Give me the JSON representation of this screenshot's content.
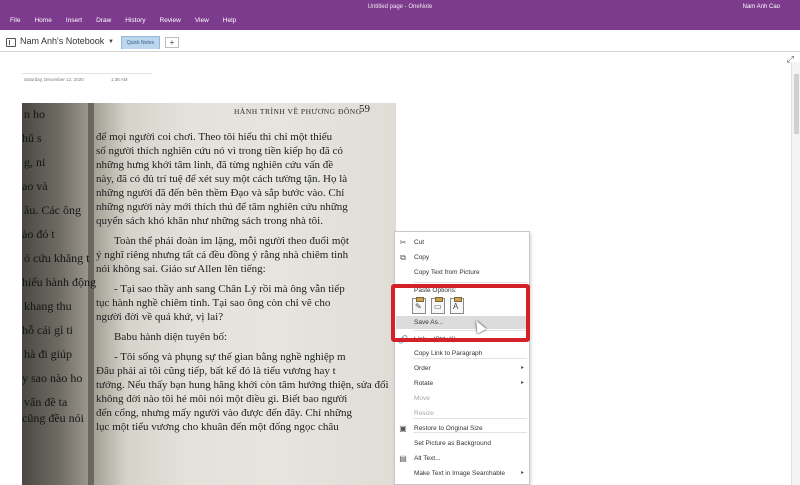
{
  "window": {
    "title": "Untitled page - OneNote",
    "user": "Nam Anh Cao"
  },
  "menu": [
    "File",
    "Home",
    "Insert",
    "Draw",
    "History",
    "Review",
    "View",
    "Help"
  ],
  "notebook": {
    "name": "Nam Anh's Notebook",
    "tab": "Quick Notes",
    "add_tab": "+"
  },
  "page": {
    "date": "Saturday, December 12, 2020",
    "time": "1:36 AM"
  },
  "photo": {
    "header": "HÀNH TRÌNH VỀ PHƯƠNG ĐÔNG",
    "page_number": "59",
    "lines": [
      "để mọi người coi chơi. Theo tôi hiểu thì chỉ một thiểu",
      "số người thích nghiên cứu nó vì trong tiền kiếp họ đã có",
      "những hưng khởi tâm linh, đã từng nghiên cứu vấn đề",
      "này, đã có đủ trí tuệ để xét suy một cách tường tận. Họ là",
      "những người đã đến bên thềm Đạo và sắp bước vào. Chỉ",
      "những người này mới thích thú để tâm nghiên cứu những",
      "quyển sách khó khăn như những sách trong nhà tôi.",
      "",
      "Toàn thể phái đoàn im lặng, mỗi người theo đuổi một",
      "ý nghĩ riêng nhưng tất cả đều đồng ý rằng nhà chiêm tinh",
      "nói không sai. Giáo sư Allen lên tiếng:",
      "",
      "- Tại sao thầy anh sang Chân Lý rồi mà ông vẫn tiếp",
      "tục hành nghề chiêm tinh. Tại sao ông còn chỉ vẽ cho",
      "người đời về quá khứ, vị lai?",
      "",
      "Babu hành diện tuyên bố:",
      "",
      "- Tôi sống và phụng sự thế gian bằng nghề nghiệp m",
      "Đâu phải ai tôi cũng tiếp, bất kể đó là tiểu vương hay t",
      "tướng. Nếu thấy bạn hung hăng khởi còn tâm hướng thiện, sửa đổi",
      "không đời nào tôi hé môi nói một điều gì. Biết bao người",
      "đến cổng, nhưng mấy người vào được đến đây. Chỉ những",
      "lục một tiểu vương cho khuân đến một đống ngọc châu"
    ],
    "left_lines": [
      "n ho",
      "hũ s",
      "g, ni",
      "ao và",
      "âu. Các ông",
      "ào đó t",
      "ó cứu khăng t",
      "hiếu hành động",
      "khang thu",
      "hỗ cái gì ti",
      "hà đi giúp",
      "y sao nào ho",
      "vấn đề ta",
      "cũng đều nói"
    ]
  },
  "context_menu": {
    "items": [
      {
        "label": "Cut",
        "icon": "✂"
      },
      {
        "label": "Copy",
        "icon": "⧉"
      },
      {
        "label": "Copy Text from Picture",
        "icon": ""
      },
      {
        "label": "Paste Options:",
        "icon": ""
      },
      {
        "label": "Save As...",
        "icon": ""
      },
      {
        "label": "Link...  (Ctrl+K)",
        "icon": "🔗"
      },
      {
        "label": "Copy Link to Paragraph",
        "icon": ""
      },
      {
        "label": "Order",
        "icon": "",
        "submenu": true
      },
      {
        "label": "Rotate",
        "icon": "",
        "submenu": true
      },
      {
        "label": "Move",
        "icon": "",
        "disabled": true
      },
      {
        "label": "Resize",
        "icon": "",
        "disabled": true
      },
      {
        "label": "Restore to Original Size",
        "icon": "▣"
      },
      {
        "label": "Set Picture as Background",
        "icon": ""
      },
      {
        "label": "Alt Text...",
        "icon": "▤"
      },
      {
        "label": "Make Text in Image Searchable",
        "icon": "",
        "submenu": true
      }
    ],
    "paste_icons": [
      "paste-keep-formatting-icon",
      "paste-picture-icon",
      "paste-text-only-icon"
    ]
  },
  "colors": {
    "titlebar": "#7c3b8c",
    "annotation": "#d32029"
  }
}
